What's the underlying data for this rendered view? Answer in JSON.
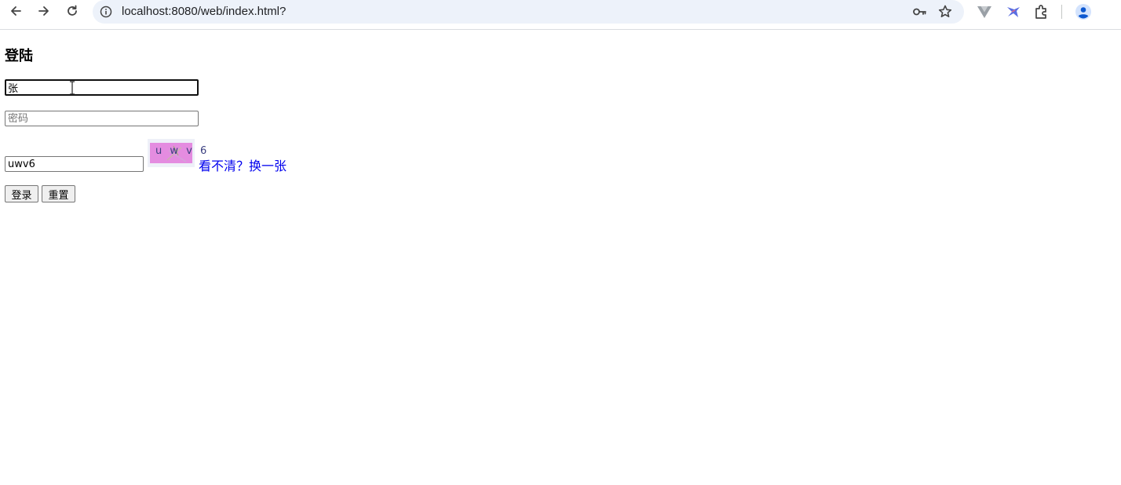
{
  "browser": {
    "url": "localhost:8080/web/index.html?",
    "icons": [
      "back-arrow-icon",
      "forward-arrow-icon",
      "reload-icon",
      "site-info-icon",
      "password-key-icon",
      "bookmark-star-icon",
      "vue-devtools-extension-icon",
      "bird-extension-icon",
      "extensions-puzzle-icon",
      "profile-avatar-icon"
    ]
  },
  "page": {
    "title": "登陆",
    "username": {
      "value": "张",
      "placeholder": ""
    },
    "password": {
      "value": "",
      "placeholder": "密码"
    },
    "captcha": {
      "value": "uwv6",
      "image_text": "u w v 6"
    },
    "refresh_link": "看不清？换一张",
    "buttons": {
      "login": "登录",
      "reset": "重置"
    }
  }
}
